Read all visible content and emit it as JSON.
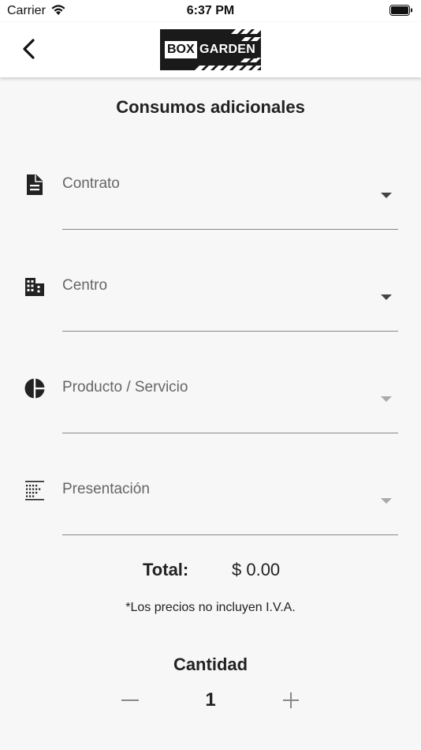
{
  "status_bar": {
    "carrier": "Carrier",
    "time": "6:37 PM"
  },
  "header": {
    "logo": {
      "part1": "BOX",
      "part2": "GARDEN"
    },
    "back_icon": "chevron-left-icon"
  },
  "page": {
    "title": "Consumos adicionales"
  },
  "form": {
    "fields": [
      {
        "label": "Contrato",
        "icon": "document-icon",
        "enabled": true
      },
      {
        "label": "Centro",
        "icon": "building-icon",
        "enabled": true
      },
      {
        "label": "Producto / Servicio",
        "icon": "pie-chart-icon",
        "enabled": false
      },
      {
        "label": "Presentación",
        "icon": "grid-list-icon",
        "enabled": false
      }
    ]
  },
  "summary": {
    "total_label": "Total:",
    "total_value": "$ 0.00",
    "note": "*Los precios no incluyen I.V.A."
  },
  "quantity": {
    "label": "Cantidad",
    "value": "1"
  },
  "colors": {
    "background": "#f7f7f7",
    "text": "#222222",
    "enabled_caret": "#444444",
    "disabled_caret": "#aaaaaa"
  }
}
